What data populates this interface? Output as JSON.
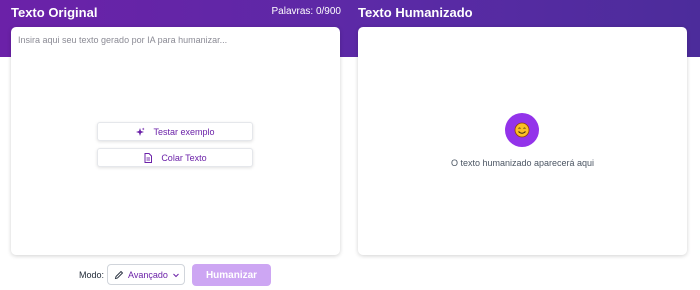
{
  "original": {
    "title": "Texto Original",
    "word_count": "Palavras: 0/900",
    "input_placeholder": "Insira aqui seu texto gerado por IA para humanizar...",
    "example_button": "Testar exemplo",
    "paste_button": "Colar Texto"
  },
  "humanized": {
    "title": "Texto Humanizado",
    "empty_message": "O texto humanizado aparecerá aqui",
    "icon": "smiley-icon"
  },
  "controls": {
    "mode_label": "Modo:",
    "mode_value": "Avançado",
    "humanize_button": "Humanizar"
  },
  "colors": {
    "brand": "#6b21a8",
    "accent": "#9333ea",
    "button_disabled": "#cda6f3"
  }
}
